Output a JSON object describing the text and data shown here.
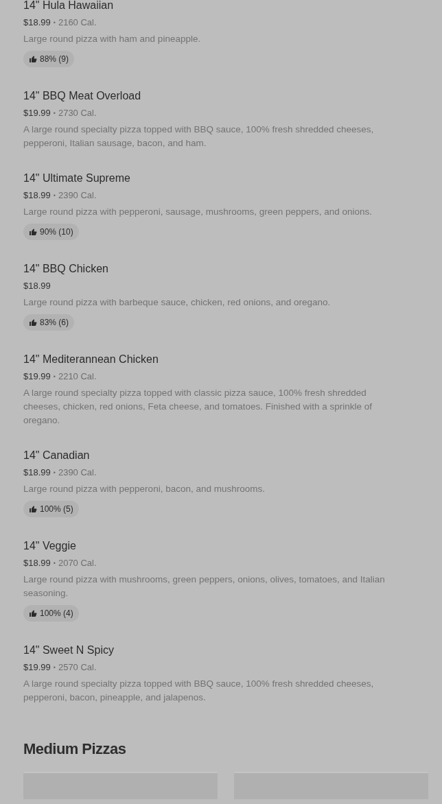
{
  "items": [
    {
      "title": "14\" Hula Hawaiian",
      "price": "$18.99",
      "separator": "•",
      "calories": "2160 Cal.",
      "description": "Large round pizza with ham and pineapple.",
      "rating": "88% (9)"
    },
    {
      "title": "14\" BBQ Meat Overload",
      "price": "$19.99",
      "separator": "•",
      "calories": "2730 Cal.",
      "description": "A large round specialty pizza topped with BBQ sauce, 100% fresh shredded cheeses, pepperoni, Italian sausage, bacon, and ham."
    },
    {
      "title": "14\" Ultimate Supreme",
      "price": "$18.99",
      "separator": "•",
      "calories": "2390 Cal.",
      "description": "Large round pizza with pepperoni, sausage, mushrooms, green peppers, and onions.",
      "rating": "90% (10)"
    },
    {
      "title": "14\" BBQ Chicken",
      "price": "$18.99",
      "description": "Large round pizza with barbeque sauce, chicken, red onions, and oregano.",
      "rating": "83% (6)"
    },
    {
      "title": "14\" Mediterannean Chicken",
      "price": "$19.99",
      "separator": "•",
      "calories": "2210 Cal.",
      "description": "A large round specialty pizza topped with classic pizza sauce, 100% fresh shredded cheeses, chicken, red onions, Feta cheese, and tomatoes. Finished with a sprinkle of oregano."
    },
    {
      "title": "14\" Canadian",
      "price": "$18.99",
      "separator": "•",
      "calories": "2390 Cal.",
      "description": "Large round pizza with pepperoni, bacon, and mushrooms.",
      "rating": "100% (5)"
    },
    {
      "title": "14\" Veggie",
      "price": "$18.99",
      "separator": "•",
      "calories": "2070 Cal.",
      "description": "Large round pizza with mushrooms, green peppers, onions, olives, tomatoes, and Italian seasoning.",
      "rating": "100% (4)"
    },
    {
      "title": "14\" Sweet N Spicy",
      "price": "$19.99",
      "separator": "•",
      "calories": "2570 Cal.",
      "description": "A large round specialty pizza topped with BBQ sauce, 100% fresh shredded cheeses, pepperoni, bacon, pineapple, and jalapenos."
    }
  ],
  "next_section": {
    "title": "Medium Pizzas",
    "cards": [
      {
        "kind": "placeholder"
      },
      {
        "kind": "placeholder"
      }
    ]
  }
}
